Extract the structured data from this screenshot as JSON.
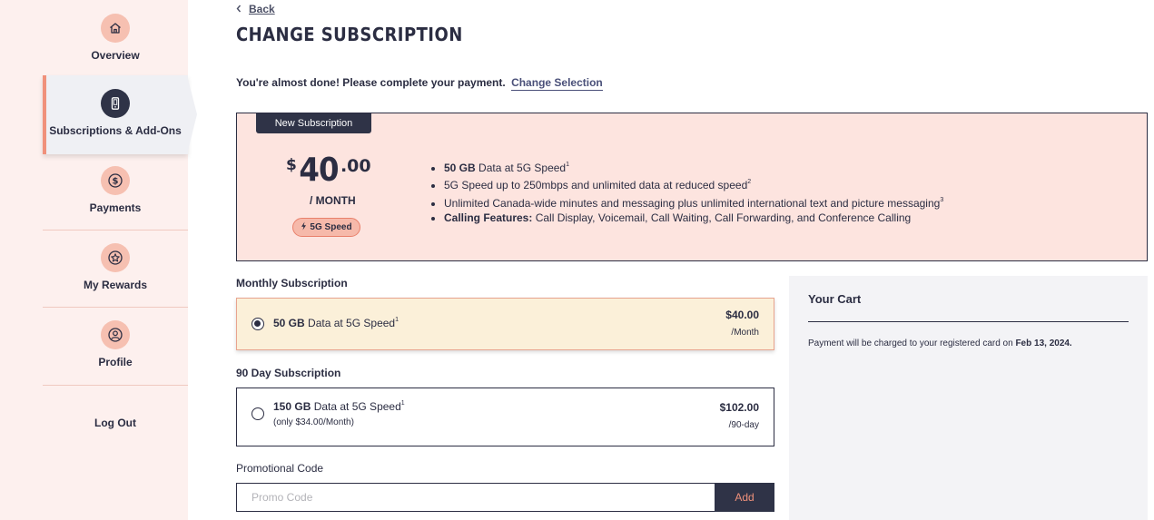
{
  "sidebar": {
    "items": [
      {
        "label": "Overview",
        "icon": "home-icon"
      },
      {
        "label": "Subscriptions & Add-Ons",
        "icon": "phone-icon",
        "active": true
      },
      {
        "label": "Payments",
        "icon": "dollar-icon"
      },
      {
        "label": "My Rewards",
        "icon": "star-icon"
      },
      {
        "label": "Profile",
        "icon": "user-icon"
      }
    ],
    "logout": "Log Out"
  },
  "header": {
    "back": "Back",
    "title": "CHANGE SUBSCRIPTION"
  },
  "notice": {
    "text": "You're almost done! Please complete your payment.",
    "link": "Change Selection"
  },
  "plan": {
    "tag": "New Subscription",
    "currency": "$",
    "price_whole": "40",
    "price_cents": ".00",
    "per": "/ MONTH",
    "badge": "5G Speed",
    "features": [
      {
        "bold": "50 GB",
        "text": " Data at 5G Speed",
        "sup": "1"
      },
      {
        "bold": "",
        "text": "5G Speed up to 250mbps and unlimited data at reduced speed",
        "sup": "2"
      },
      {
        "bold": "",
        "text": "Unlimited Canada-wide minutes and messaging plus unlimited international text and picture messaging",
        "sup": "3"
      },
      {
        "bold": "Calling Features:",
        "text": " Call Display, Voicemail, Call Waiting, Call Forwarding, and Conference Calling",
        "sup": ""
      }
    ]
  },
  "monthly": {
    "label": "Monthly Subscription",
    "option": {
      "bold": "50 GB",
      "text": " Data at 5G Speed",
      "sup": "1",
      "price": "$40.00",
      "period": "/Month",
      "selected": true
    }
  },
  "ninety": {
    "label": "90 Day Subscription",
    "option": {
      "bold": "150 GB",
      "text": " Data at 5G Speed",
      "sup": "1",
      "sub": "(only $34.00/Month)",
      "price": "$102.00",
      "period": "/90-day",
      "selected": false
    }
  },
  "promo": {
    "label": "Promotional Code",
    "placeholder": "Promo Code",
    "button": "Add"
  },
  "cart": {
    "title": "Your Cart",
    "note": "Payment will be charged to your registered card on ",
    "date": "Feb 13, 2024."
  },
  "colors": {
    "sidebar_bg": "#fdf0ee",
    "accent": "#f0917b",
    "dark": "#2f3347",
    "plan_bg": "#fde4df",
    "selected_bg": "#fbf0d9"
  }
}
